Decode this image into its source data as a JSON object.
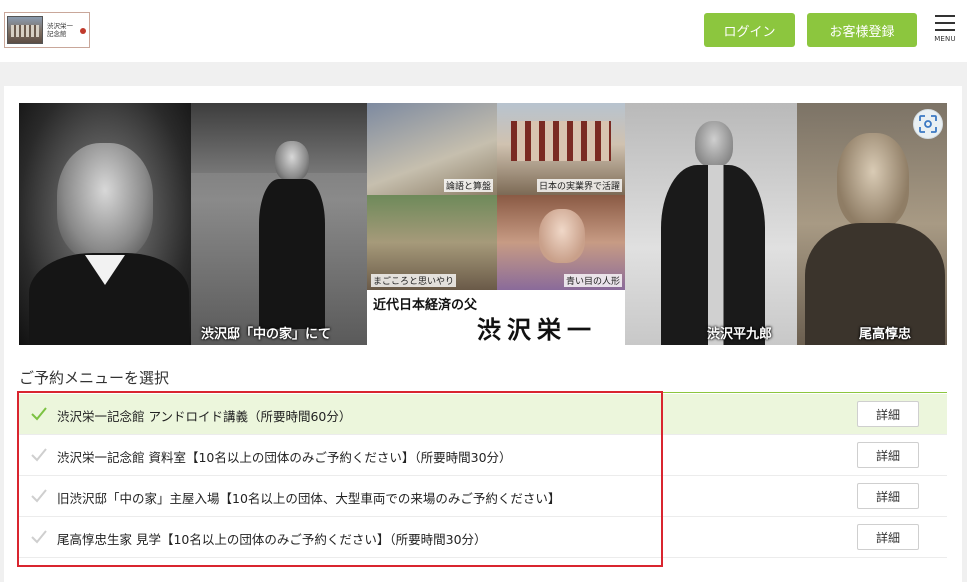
{
  "header": {
    "logo_text": "渋沢栄一\n記念館",
    "login_label": "ログイン",
    "register_label": "お客様登録",
    "menu_label": "MENU"
  },
  "banner": {
    "caption_house": "渋沢邸「中の家」にて",
    "caption_rongo": "論語と算盤",
    "caption_business": "日本の実業界で活躍",
    "caption_sincerity": "まごころと思いやり",
    "caption_dolls": "青い目の人形",
    "subtitle": "近代日本経済の父",
    "title": "渋沢栄一",
    "caption_heikuro": "渋沢平九郎",
    "caption_odaka": "尾高惇忠"
  },
  "section": {
    "title": "ご予約メニューを選択"
  },
  "menu_items": [
    {
      "label": "渋沢栄一記念館 アンドロイド講義（所要時間60分）",
      "detail": "詳細",
      "selected": true
    },
    {
      "label": "渋沢栄一記念館 資料室【10名以上の団体のみご予約ください】（所要時間30分）",
      "detail": "詳細",
      "selected": false
    },
    {
      "label": "旧渋沢邸「中の家」主屋入場【10名以上の団体、大型車両での来場のみご予約ください】",
      "detail": "詳細",
      "selected": false
    },
    {
      "label": "尾高惇忠生家 見学【10名以上の団体のみご予約ください】（所要時間30分）",
      "detail": "詳細",
      "selected": false
    }
  ],
  "colors": {
    "accent_green": "#8cc63e",
    "selected_row_bg": "#ecf6dc",
    "highlight_red": "#d9252f"
  }
}
